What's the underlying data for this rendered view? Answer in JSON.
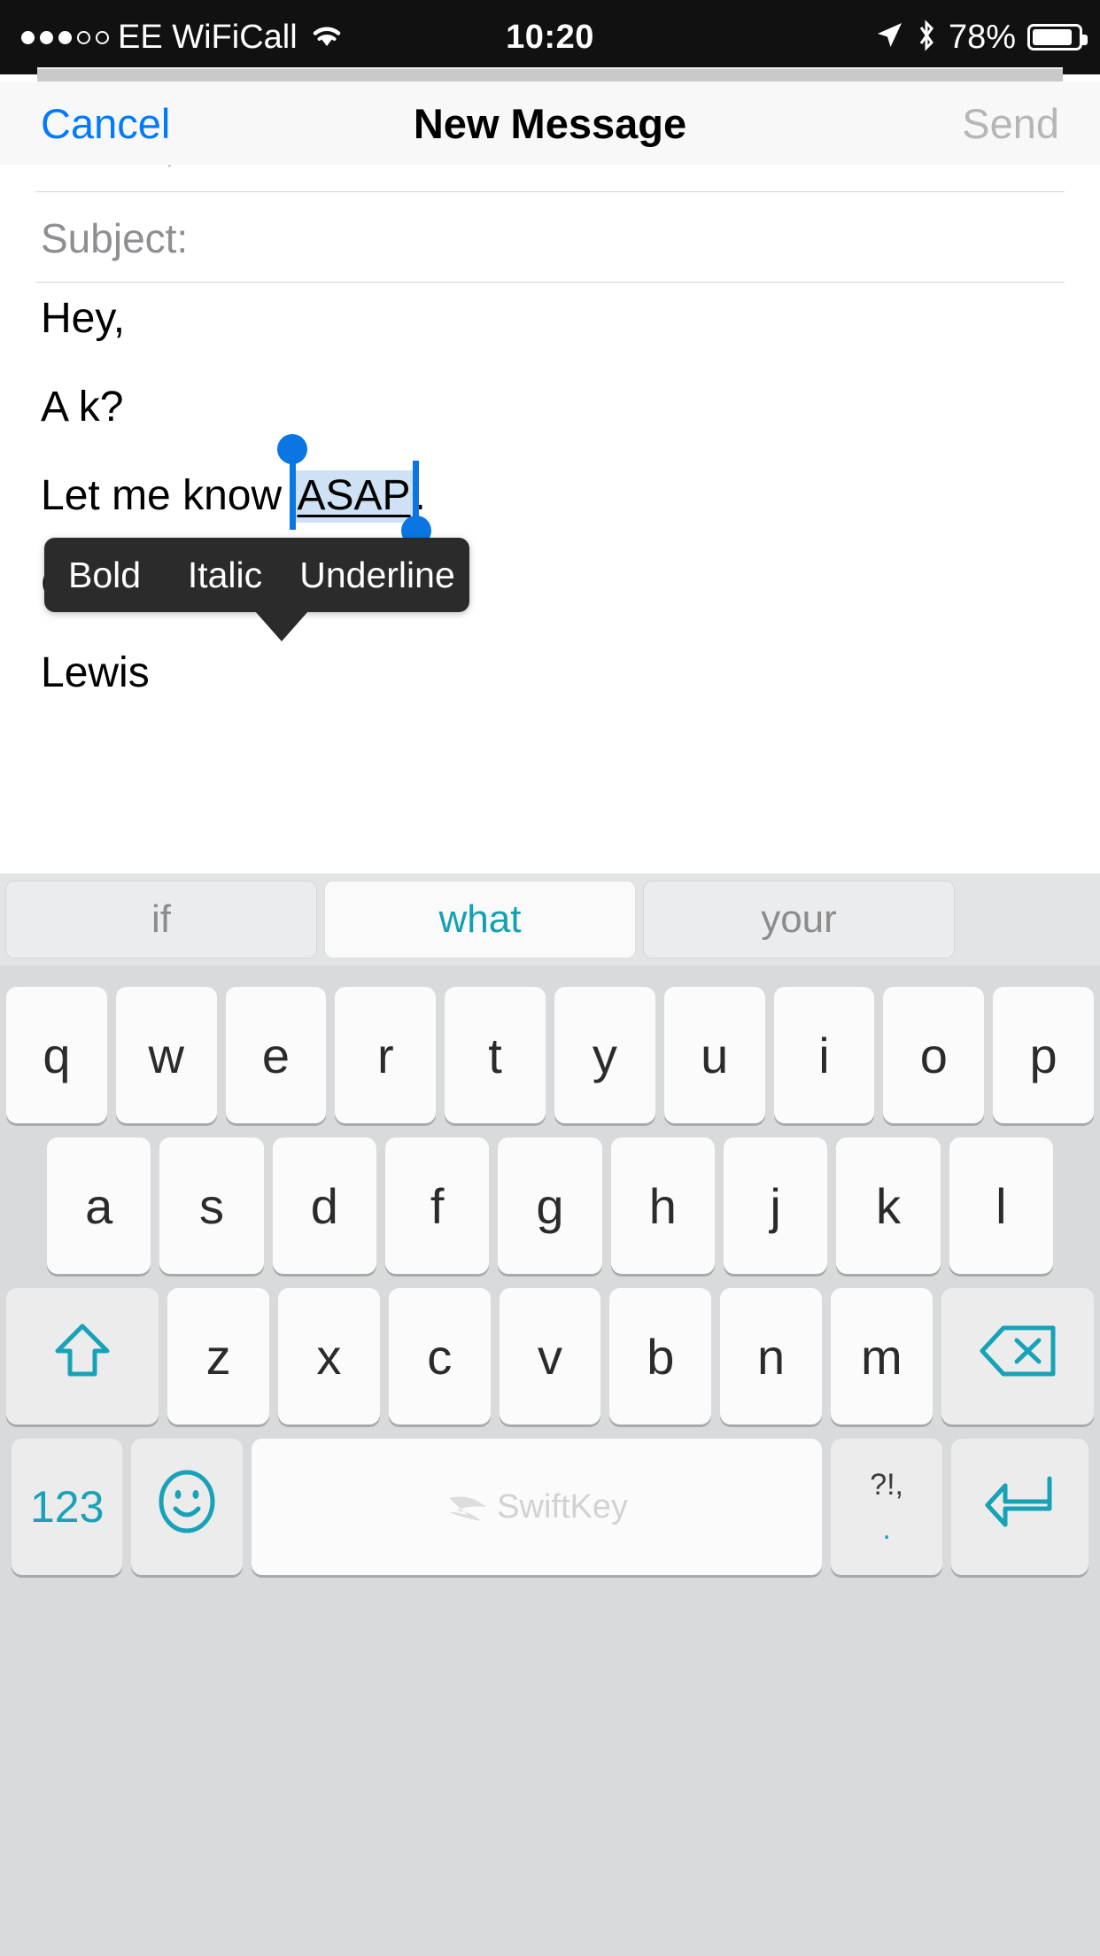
{
  "status_bar": {
    "signal_total": 5,
    "signal_filled": 3,
    "carrier": "EE WiFiCall",
    "wifi_icon": "wifi-icon",
    "time": "10:20",
    "location_icon": "location-arrow-icon",
    "bluetooth_icon": "bluetooth-icon",
    "battery_percent": "78%",
    "battery_level": 78,
    "background": "#111111",
    "foreground": "#ffffff"
  },
  "nav_bar": {
    "cancel_label": "Cancel",
    "title": "New Message",
    "send_label": "Send",
    "cancel_color": "#007aff",
    "send_color": "#b6b6b6",
    "background": "#f8f8f8"
  },
  "compose": {
    "clipped_header_row": "Cc/Bcc, From:",
    "subject_placeholder": "Subject:",
    "subject_value": "",
    "body": {
      "line_1": "Hey,",
      "line_2_obscured": "A                                k?",
      "line_3_prefix": "Let me know ",
      "line_3_selected": "ASAP",
      "line_3_suffix": ".",
      "line_4": "Cheers,",
      "line_5": "Lewis"
    },
    "selection": {
      "selected_text": "ASAP",
      "highlight_color": "#cfe1f4",
      "handle_color": "#0a76e3",
      "underlined": true
    }
  },
  "format_popup": {
    "items": [
      {
        "label": "Bold"
      },
      {
        "label": "Italic"
      },
      {
        "label": "Underline"
      }
    ],
    "background": "#2b2b2b",
    "text_color": "#ffffff"
  },
  "keyboard": {
    "app": "SwiftKey",
    "accent_color": "#18a2b8",
    "background": "#d8dadc",
    "suggestions": [
      {
        "text": "if",
        "selected": false
      },
      {
        "text": "what",
        "selected": true
      },
      {
        "text": "your",
        "selected": false
      }
    ],
    "row_1": [
      "q",
      "w",
      "e",
      "r",
      "t",
      "y",
      "u",
      "i",
      "o",
      "p"
    ],
    "row_2": [
      "a",
      "s",
      "d",
      "f",
      "g",
      "h",
      "j",
      "k",
      "l"
    ],
    "row_3": [
      "z",
      "x",
      "c",
      "v",
      "b",
      "n",
      "m"
    ],
    "shift_icon": "shift-arrow-icon",
    "backspace_icon": "backspace-icon",
    "bottom_row": {
      "numbers_label": "123",
      "emoji_icon": "emoji-smiley-icon",
      "space_label": "SwiftKey",
      "punctuation_top": "?!,",
      "punctuation_bottom": ".",
      "return_icon": "return-enter-icon"
    }
  }
}
